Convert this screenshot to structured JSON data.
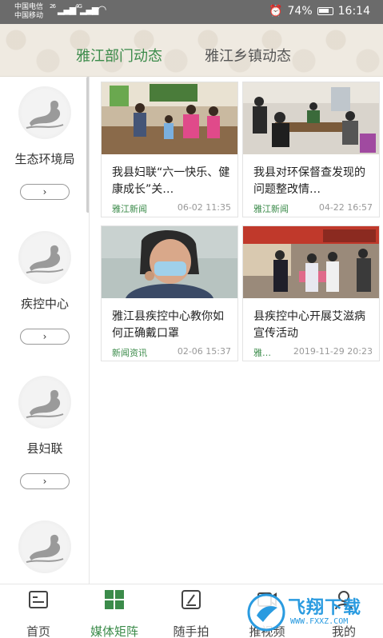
{
  "status_bar": {
    "carrier1": "中国电信",
    "carrier2": "中国移动",
    "net1": "26",
    "net2": "4G",
    "battery": "74%",
    "time": "16:14"
  },
  "header": {
    "tabs": [
      {
        "label": "雅江部门动态",
        "active": true
      },
      {
        "label": "雅江乡镇动态",
        "active": false
      }
    ]
  },
  "sidebar": {
    "items": [
      {
        "label": "生态环境局",
        "button": "›"
      },
      {
        "label": "疾控中心",
        "button": "›"
      },
      {
        "label": "县妇联",
        "button": "›"
      },
      {
        "label": "",
        "button": ""
      }
    ]
  },
  "cards": [
    {
      "title": "我县妇联“六一快乐、健康成长”关…",
      "source": "雅江新闻",
      "time": "06-02 11:35"
    },
    {
      "title": "我县对环保督查发现的问题整改情…",
      "source": "雅江新闻",
      "time": "04-22 16:57"
    },
    {
      "title": "雅江县疾控中心教你如何正确戴口罩",
      "source": "新闻资讯",
      "time": "02-06 15:37"
    },
    {
      "title": "县疾控中心开展艾滋病宣传活动",
      "source": "雅…",
      "time": "2019-11-29 20:23"
    }
  ],
  "bottom_nav": {
    "items": [
      {
        "label": "首页",
        "icon": "home-icon",
        "active": false
      },
      {
        "label": "媒体矩阵",
        "icon": "grid-icon",
        "active": true
      },
      {
        "label": "随手拍",
        "icon": "edit-icon",
        "active": false
      },
      {
        "label": "推视频",
        "icon": "video-icon",
        "active": false
      },
      {
        "label": "我的",
        "icon": "user-icon",
        "active": false
      }
    ]
  },
  "watermark": {
    "text": "飞翔下载",
    "url": "WWW.FXXZ.COM"
  },
  "colors": {
    "accent": "#3b8b4a",
    "header_bg": "#efeae1",
    "status_bg": "#6b6b6b"
  }
}
